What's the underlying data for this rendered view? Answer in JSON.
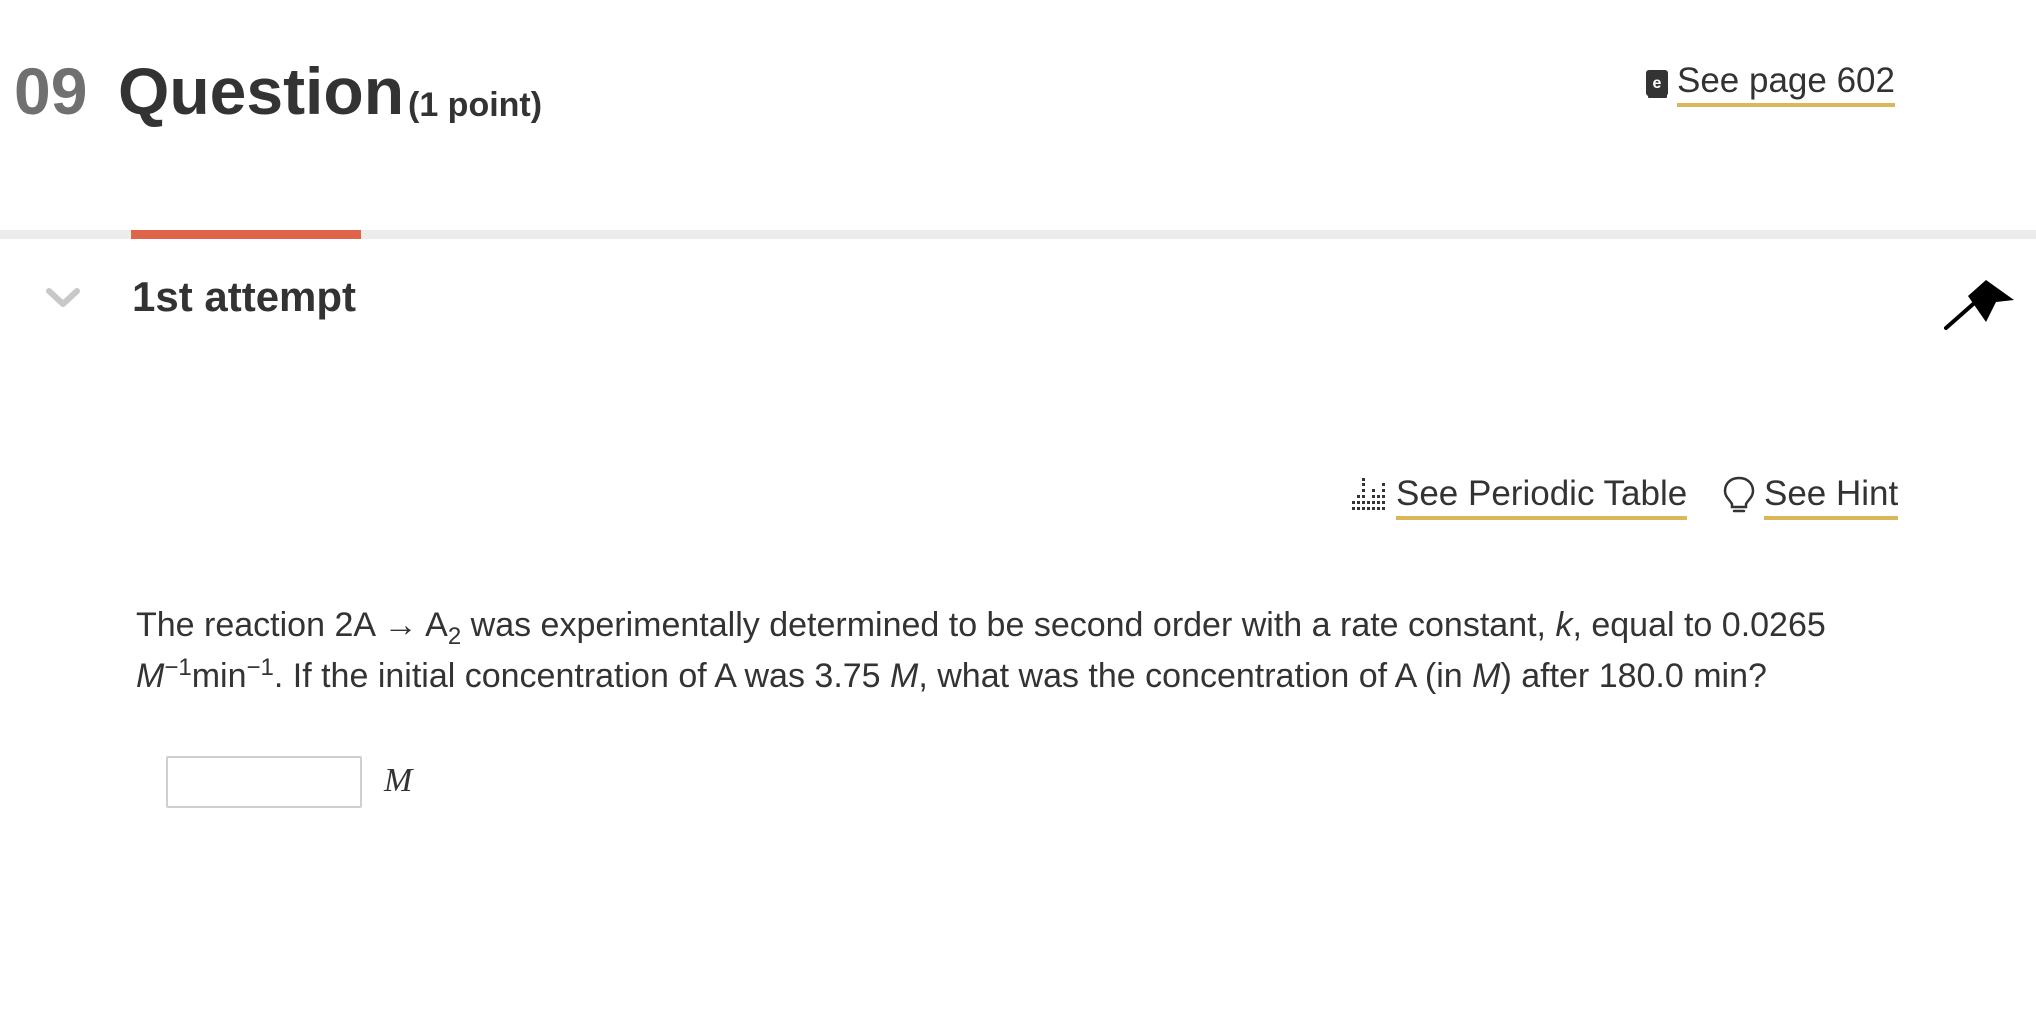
{
  "header": {
    "question_number": "09",
    "question_label": "Question",
    "points": "(1 point)",
    "see_page_label": "See page 602"
  },
  "attempt": {
    "title": "1st attempt"
  },
  "tools": {
    "periodic_table_label": "See Periodic Table",
    "hint_label": "See Hint"
  },
  "question": {
    "line1_a": "The reaction 2A → A",
    "line1_sub": "2",
    "line1_b": " was experimentally determined to be second order with a rate constant, ",
    "line1_k": "k",
    "line1_c": ", equal to 0.0265",
    "line2_M1": "M",
    "line2_sup1": "−1",
    "line2_min": "min",
    "line2_sup2": "−1",
    "line2_b": ". If the initial concentration of A was 3.75 ",
    "line2_M2": "M",
    "line2_c": ", what was the concentration of A (in ",
    "line2_M3": "M",
    "line2_d": ") after 180.0 min?"
  },
  "answer": {
    "value": "",
    "placeholder": "",
    "unit": "M"
  },
  "colors": {
    "accent_tab": "#e0644a",
    "link_underline": "#d9b75a",
    "text": "#333333",
    "question_number": "#707070"
  },
  "icons": {
    "ebook": "ebook-icon",
    "periodic_table": "periodic-table-icon",
    "hint": "lightbulb-icon",
    "collapse": "chevron-down-icon",
    "flag": "flag-icon"
  }
}
